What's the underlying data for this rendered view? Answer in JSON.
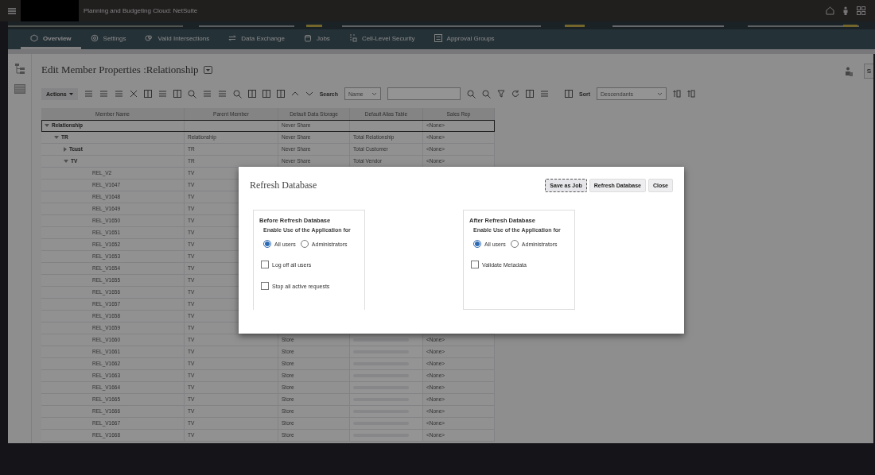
{
  "topbar": {
    "title": "Planning and Budgeting Cloud:  NetSuite"
  },
  "nav": {
    "tabs": [
      {
        "label": "Overview",
        "selected": true
      },
      {
        "label": "Settings",
        "selected": false
      },
      {
        "label": "Valid Intersections",
        "selected": false
      },
      {
        "label": "Data Exchange",
        "selected": false
      },
      {
        "label": "Jobs",
        "selected": false
      },
      {
        "label": "Cell-Level Security",
        "selected": false
      },
      {
        "label": "Approval Groups",
        "selected": false
      }
    ]
  },
  "page": {
    "title": "Edit Member Properties :Relationship",
    "edge_button": "S"
  },
  "toolbar": {
    "actions": "Actions",
    "search_label": "Search",
    "search_by": "Name",
    "sort_label": "Sort",
    "sort_value": "Descendants"
  },
  "table": {
    "columns": [
      "Member Name",
      "Parent Member",
      "Default Data Storage",
      "Default Alias Table",
      "Sales Rep"
    ],
    "rows": [
      {
        "member": "Relationship",
        "storage": "Never Share",
        "sales_rep": "<None>",
        "selected": true,
        "expanded": true,
        "children": [
          {
            "member": "TR",
            "parent": "Relationship",
            "storage": "Never Share",
            "alias": "Total Relationship",
            "sales_rep": "<None>",
            "selected": false,
            "expanded": true,
            "children": [
              {
                "member": "Tcust",
                "parent": "TR",
                "storage": "Never Share",
                "alias": "Total Customer",
                "sales_rep": "<None>",
                "selected": false,
                "expanded": false
              },
              {
                "member": "TV",
                "parent": "TR",
                "storage": "Never Share",
                "alias": "Total Vendor",
                "sales_rep": "<None>",
                "selected": false,
                "expanded": true,
                "children": [
                  {
                    "member": "REL_V2",
                    "parent": "TV",
                    "selected": false
                  },
                  {
                    "member": "REL_V1647",
                    "parent": "TV",
                    "selected": false
                  },
                  {
                    "member": "REL_V1648",
                    "parent": "TV",
                    "selected": false
                  },
                  {
                    "member": "REL_V1649",
                    "parent": "TV",
                    "selected": false
                  },
                  {
                    "member": "REL_V1650",
                    "parent": "TV",
                    "selected": false
                  },
                  {
                    "member": "REL_V1651",
                    "parent": "TV",
                    "selected": false
                  },
                  {
                    "member": "REL_V1652",
                    "parent": "TV",
                    "selected": false
                  },
                  {
                    "member": "REL_V1653",
                    "parent": "TV",
                    "selected": false
                  },
                  {
                    "member": "REL_V1654",
                    "parent": "TV",
                    "selected": false
                  },
                  {
                    "member": "REL_V1655",
                    "parent": "TV",
                    "selected": false
                  },
                  {
                    "member": "REL_V1656",
                    "parent": "TV",
                    "selected": false
                  },
                  {
                    "member": "REL_V1657",
                    "parent": "TV",
                    "selected": false
                  },
                  {
                    "member": "REL_V1658",
                    "parent": "TV",
                    "selected": false
                  },
                  {
                    "member": "REL_V1659",
                    "parent": "TV",
                    "selected": false
                  },
                  {
                    "member": "REL_V1660",
                    "parent": "TV",
                    "storage": "Store",
                    "sales_rep": "<None>",
                    "alias_blurred": true,
                    "selected": false
                  },
                  {
                    "member": "REL_V1661",
                    "parent": "TV",
                    "storage": "Store",
                    "sales_rep": "<None>",
                    "alias_blurred": true,
                    "selected": false
                  },
                  {
                    "member": "REL_V1662",
                    "parent": "TV",
                    "storage": "Store",
                    "sales_rep": "<None>",
                    "alias_blurred": true,
                    "selected": false
                  },
                  {
                    "member": "REL_V1663",
                    "parent": "TV",
                    "storage": "Store",
                    "sales_rep": "<None>",
                    "alias_blurred": true,
                    "selected": false
                  },
                  {
                    "member": "REL_V1664",
                    "parent": "TV",
                    "storage": "Store",
                    "sales_rep": "<None>",
                    "alias_blurred": true,
                    "selected": false
                  },
                  {
                    "member": "REL_V1665",
                    "parent": "TV",
                    "storage": "Store",
                    "sales_rep": "<None>",
                    "alias_blurred": true,
                    "selected": false
                  },
                  {
                    "member": "REL_V1666",
                    "parent": "TV",
                    "storage": "Store",
                    "sales_rep": "<None>",
                    "alias_blurred": true,
                    "selected": false
                  },
                  {
                    "member": "REL_V1667",
                    "parent": "TV",
                    "storage": "Store",
                    "sales_rep": "<None>",
                    "alias_blurred": true,
                    "selected": false
                  },
                  {
                    "member": "REL_V1668",
                    "parent": "TV",
                    "storage": "Store",
                    "sales_rep": "<None>",
                    "alias_blurred": true,
                    "selected": false
                  }
                ]
              }
            ]
          }
        ]
      }
    ]
  },
  "dialog": {
    "title": "Refresh Database",
    "buttons": [
      {
        "label": "Save as Job",
        "focused": true
      },
      {
        "label": "Refresh Database",
        "focused": false
      },
      {
        "label": "Close",
        "focused": false
      }
    ],
    "sections": [
      {
        "heading": "Before Refresh Database",
        "subheading": "Enable Use of the Application for",
        "radios": [
          {
            "label": "All users",
            "selected": true
          },
          {
            "label": "Administrators",
            "selected": false
          }
        ],
        "checkboxes": [
          {
            "label": "Log off all users",
            "checked": false
          },
          {
            "label": "Stop all active requests",
            "checked": false
          }
        ]
      },
      {
        "heading": "After Refresh Database",
        "subheading": "Enable Use of the Application for",
        "radios": [
          {
            "label": "All users",
            "selected": true
          },
          {
            "label": "Administrators",
            "selected": false
          }
        ],
        "checkboxes": [
          {
            "label": "Validate Metadata",
            "checked": false
          }
        ]
      }
    ]
  }
}
